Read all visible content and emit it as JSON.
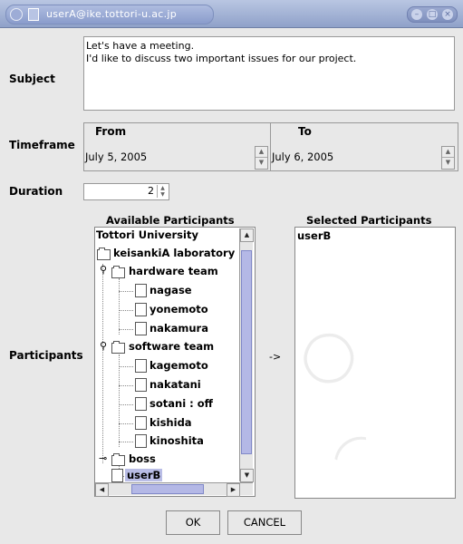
{
  "window": {
    "title": "userA@ike.tottori-u.ac.jp"
  },
  "labels": {
    "subject": "Subject",
    "timeframe": "Timeframe",
    "duration": "Duration",
    "participants": "Participants"
  },
  "subject": {
    "line1": "Let's have a meeting.",
    "line2": "I'd like to discuss two important issues for our project."
  },
  "timeframe": {
    "from_label": "From",
    "from_value": "July 5, 2005",
    "to_label": "To",
    "to_value": "July 6, 2005"
  },
  "duration": {
    "value": "2"
  },
  "participants": {
    "available_header": "Available Participants",
    "selected_header": "Selected Participants",
    "arrow": "->",
    "tree": {
      "root": "Tottori University",
      "lab": "keisankiA laboratory",
      "hardware_team": "hardware team",
      "hardware_members": [
        "nagase",
        "yonemoto",
        "nakamura"
      ],
      "software_team": "software team",
      "software_members": [
        "kagemoto",
        "nakatani",
        "sotani : off",
        "kishida",
        "kinoshita"
      ],
      "boss": "boss",
      "boss_member": "userB"
    },
    "selected": [
      "userB"
    ]
  },
  "buttons": {
    "ok": "OK",
    "cancel": "CANCEL"
  }
}
